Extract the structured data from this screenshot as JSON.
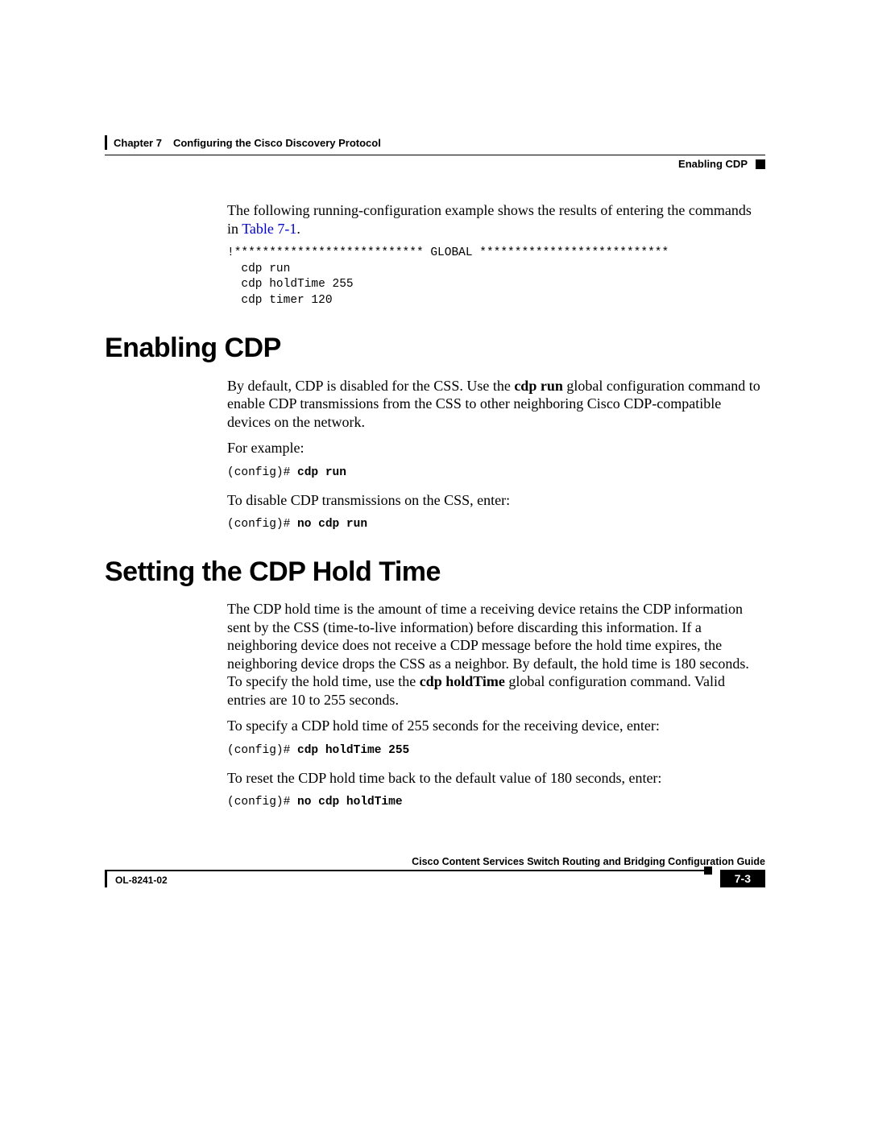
{
  "header": {
    "chapter": "Chapter 7",
    "chapter_title": "Configuring the Cisco Discovery Protocol",
    "section": "Enabling CDP"
  },
  "intro": {
    "p1a": "The following running-configuration example shows the results of entering the commands in ",
    "table_ref": "Table 7-1",
    "p1b": ".",
    "code": "!*************************** GLOBAL ***************************\n  cdp run\n  cdp holdTime 255\n  cdp timer 120"
  },
  "enabling": {
    "heading": "Enabling CDP",
    "p1a": "By default, CDP is disabled for the CSS. Use the ",
    "bold1": "cdp run",
    "p1b": " global configuration command to enable CDP transmissions from the CSS to other neighboring Cisco CDP-compatible devices on the network.",
    "p2": "For example:",
    "code1_prompt": "(config)# ",
    "code1_cmd": "cdp run",
    "p3": "To disable CDP transmissions on the CSS, enter:",
    "code2_prompt": "(config)# ",
    "code2_cmd": "no cdp run"
  },
  "holdtime": {
    "heading": "Setting the CDP Hold Time",
    "p1a": "The CDP hold time is the amount of time a receiving device retains the CDP information sent by the CSS (time-to-live information) before discarding this information. If a neighboring device does not receive a CDP message before the hold time expires, the neighboring device drops the CSS as a neighbor. By default, the hold time is 180 seconds. To specify the hold time, use the ",
    "bold1": "cdp holdTime",
    "p1b": " global configuration command. Valid entries are 10 to 255 seconds.",
    "p2": "To specify a CDP hold time of 255 seconds for the receiving device, enter:",
    "code1_prompt": "(config)# ",
    "code1_cmd": "cdp holdTime 255",
    "p3": "To reset the CDP hold time back to the default value of 180 seconds, enter:",
    "code2_prompt": "(config)# ",
    "code2_cmd": "no cdp holdTime"
  },
  "footer": {
    "guide": "Cisco Content Services Switch Routing and Bridging Configuration Guide",
    "doc": "OL-8241-02",
    "page": "7-3"
  }
}
